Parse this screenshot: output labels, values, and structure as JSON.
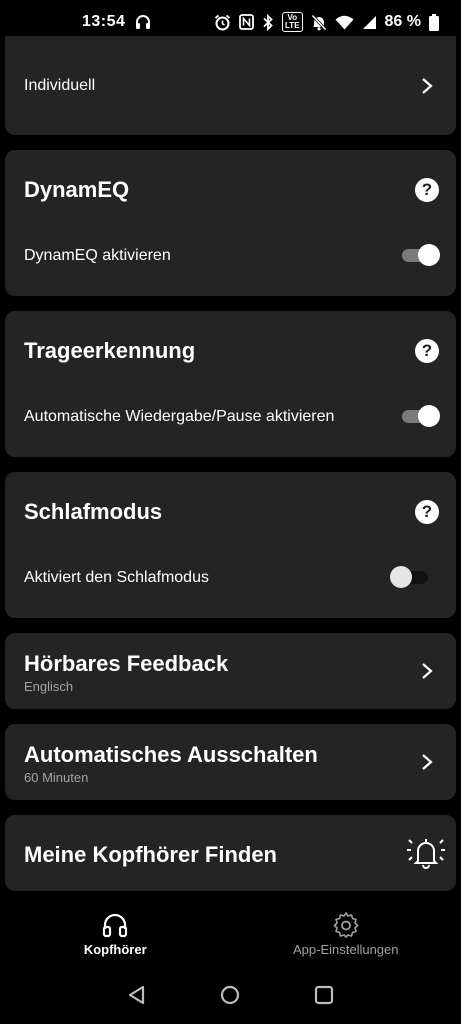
{
  "status_bar": {
    "time": "13:54",
    "battery": "86 %",
    "lte_label": "Vo\nLTE",
    "icons": [
      "headphones-icon",
      "alarm-icon",
      "nfc-icon",
      "bluetooth-icon",
      "volte-icon",
      "mute-icon",
      "wifi-icon",
      "signal-icon",
      "battery-icon"
    ]
  },
  "top_card": {
    "label": "Individuell"
  },
  "dynameq": {
    "title": "DynamEQ",
    "help": "?",
    "toggle_label": "DynamEQ aktivieren",
    "toggle_on": true
  },
  "trageerkennung": {
    "title": "Trageerkennung",
    "help": "?",
    "toggle_label": "Automatische Wiedergabe/Pause aktivieren",
    "toggle_on": true
  },
  "schlafmodus": {
    "title": "Schlafmodus",
    "help": "?",
    "toggle_label": "Aktiviert den Schlafmodus",
    "toggle_on": false
  },
  "hoerbares_feedback": {
    "title": "Hörbares Feedback",
    "subtitle": "Englisch"
  },
  "auto_off": {
    "title": "Automatisches Ausschalten",
    "subtitle": "60 Minuten"
  },
  "find": {
    "title": "Meine Kopfhörer Finden"
  },
  "bottom_nav": [
    {
      "label": "Kopfhörer",
      "icon": "headphones-icon",
      "active": true
    },
    {
      "label": "App-Einstellungen",
      "icon": "gear-icon",
      "active": false
    }
  ],
  "system_nav": [
    "back-icon",
    "home-icon",
    "recents-icon"
  ],
  "colors": {
    "background": "#000000",
    "card": "#242424",
    "subtitle": "#a3a3a3"
  }
}
